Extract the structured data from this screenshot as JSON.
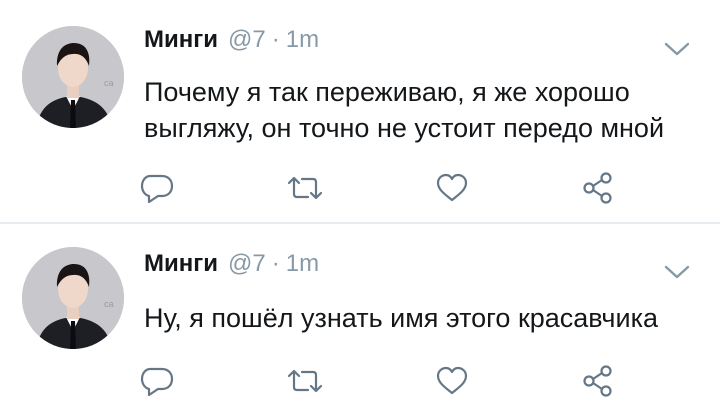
{
  "tweets": [
    {
      "author_name": "Минги",
      "handle": "@7",
      "separator": "·",
      "time": "1m",
      "text": "Почему я так переживаю, я же хорошо выгляжу, он точно не устоит передо мной",
      "actions": [
        "reply-icon",
        "retweet-icon",
        "like-icon",
        "share-icon"
      ]
    },
    {
      "author_name": "Минги",
      "handle": "@7",
      "separator": "·",
      "time": "1m",
      "text": "Ну, я пошёл узнать имя этого красавчика",
      "actions": [
        "reply-icon",
        "retweet-icon",
        "like-icon",
        "share-icon"
      ]
    }
  ],
  "colors": {
    "text_primary": "#14171a",
    "text_secondary": "#8899a6",
    "icon": "#657786",
    "divider": "#e6ecf0"
  }
}
